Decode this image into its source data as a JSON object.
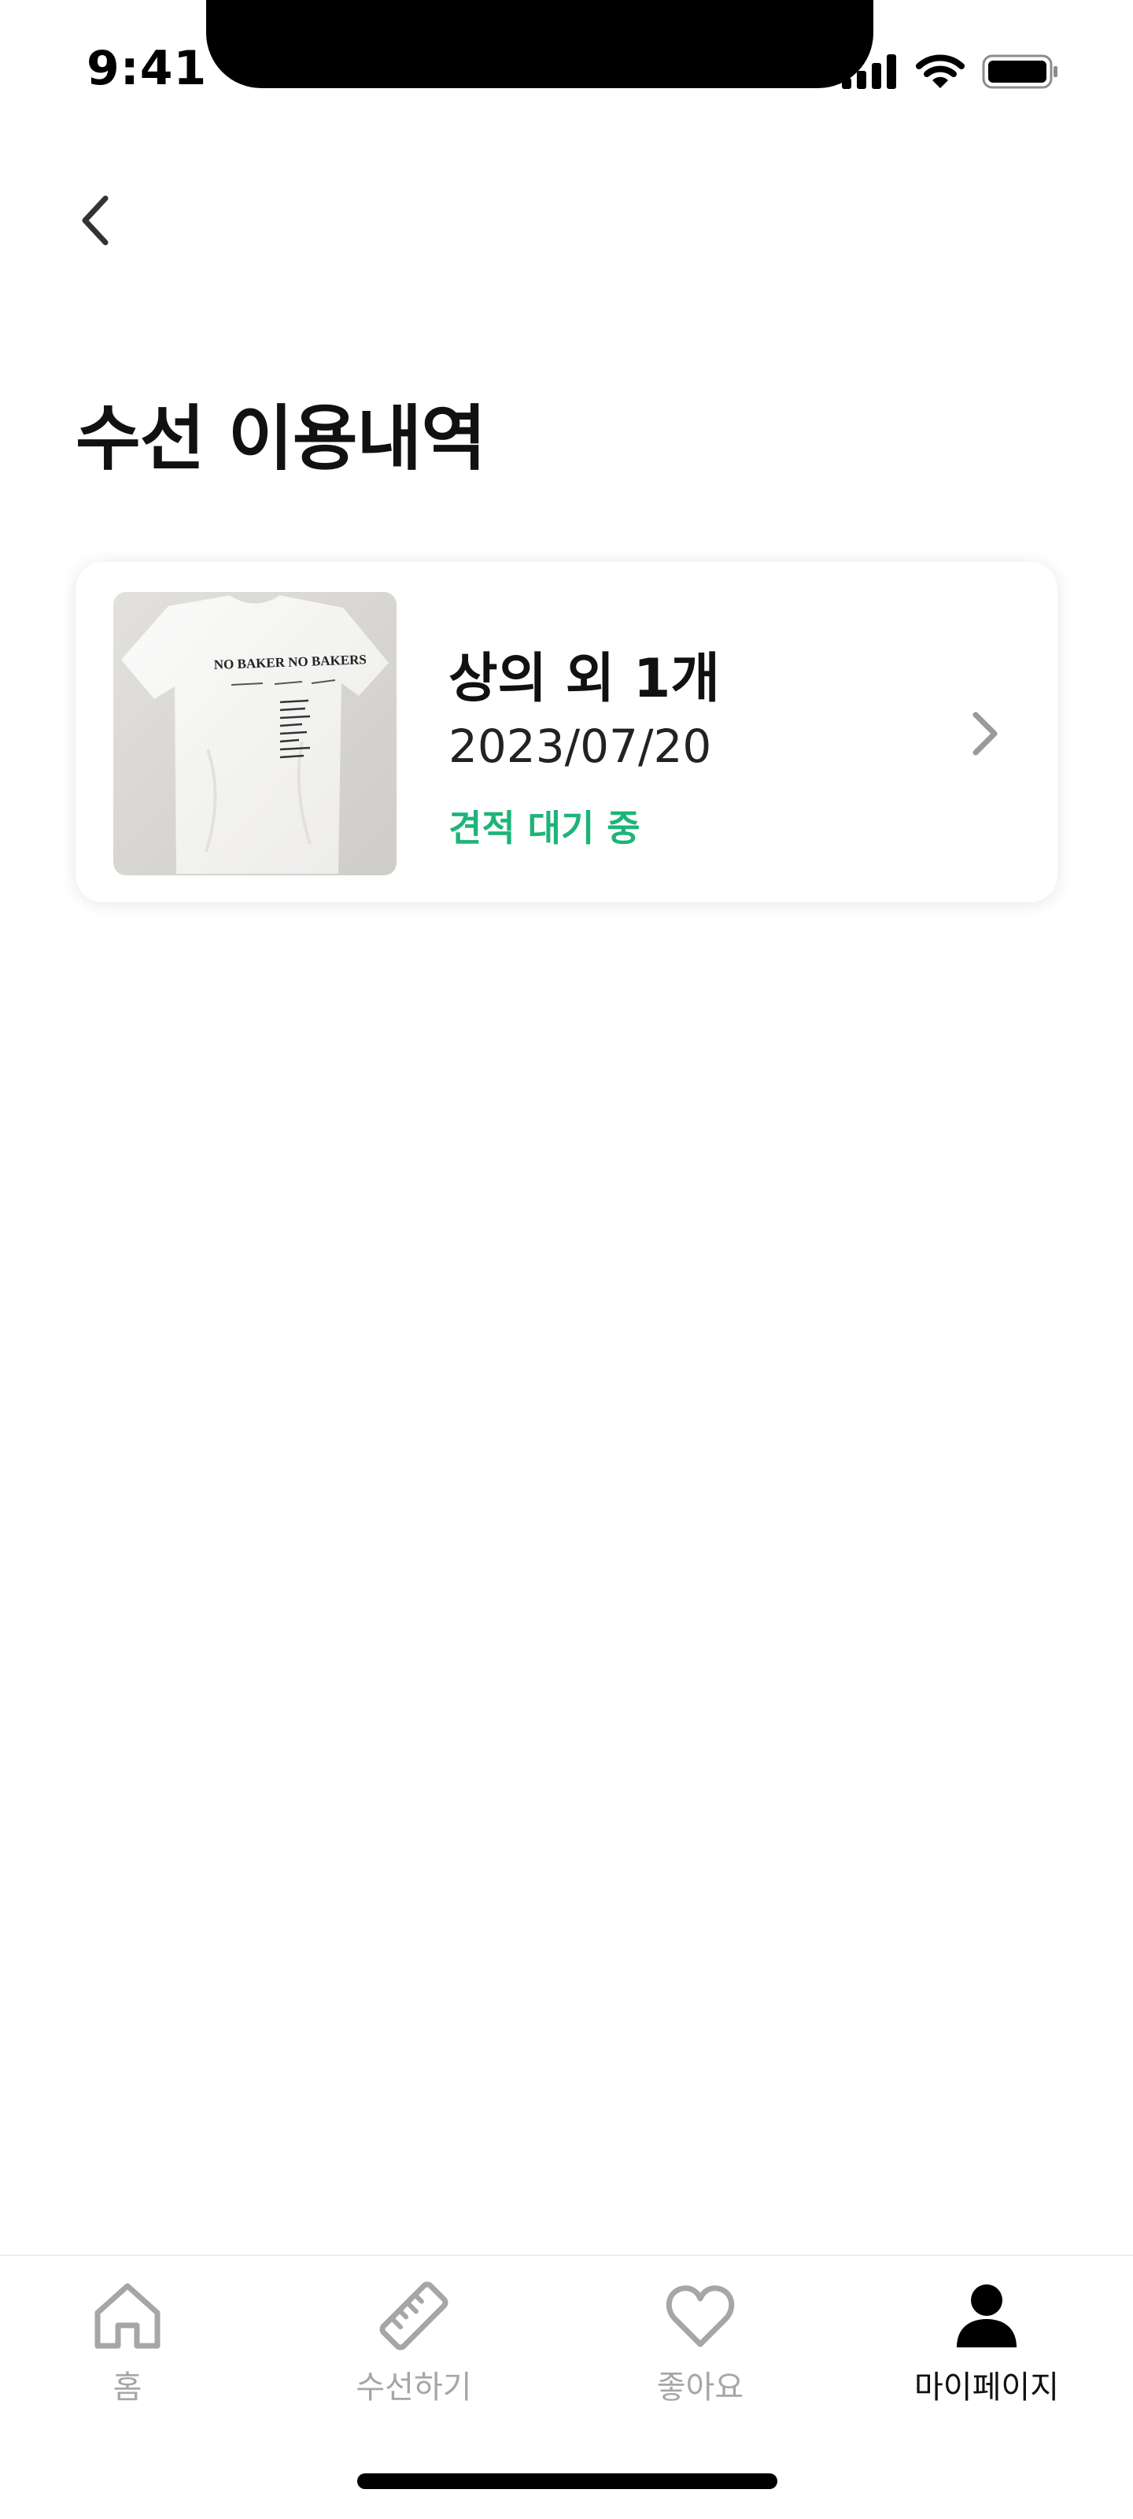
{
  "status_bar": {
    "time": "9:41",
    "icons": [
      "cellular-signal-icon",
      "wifi-icon",
      "battery-icon"
    ]
  },
  "header": {
    "back_icon": "chevron-left-icon",
    "title": "수선 이용내역"
  },
  "orders": [
    {
      "image": "white-tshirt-photo",
      "image_text": "NO BAKER NO BAKERS",
      "title": "상의 외 1개",
      "date": "2023/07/20",
      "status": "견적 대기 중",
      "chevron_icon": "chevron-right-icon"
    }
  ],
  "tab_bar": {
    "active": "mypage",
    "items": [
      {
        "id": "home",
        "label": "홈",
        "icon": "home-icon"
      },
      {
        "id": "repair",
        "label": "수선하기",
        "icon": "ruler-icon"
      },
      {
        "id": "likes",
        "label": "좋아요",
        "icon": "heart-icon"
      },
      {
        "id": "mypage",
        "label": "마이페이지",
        "icon": "person-icon"
      }
    ]
  },
  "colors": {
    "accent_green": "#1db478",
    "inactive_gray": "#a6a6a6",
    "text_primary": "#111111",
    "background": "#ffffff"
  }
}
